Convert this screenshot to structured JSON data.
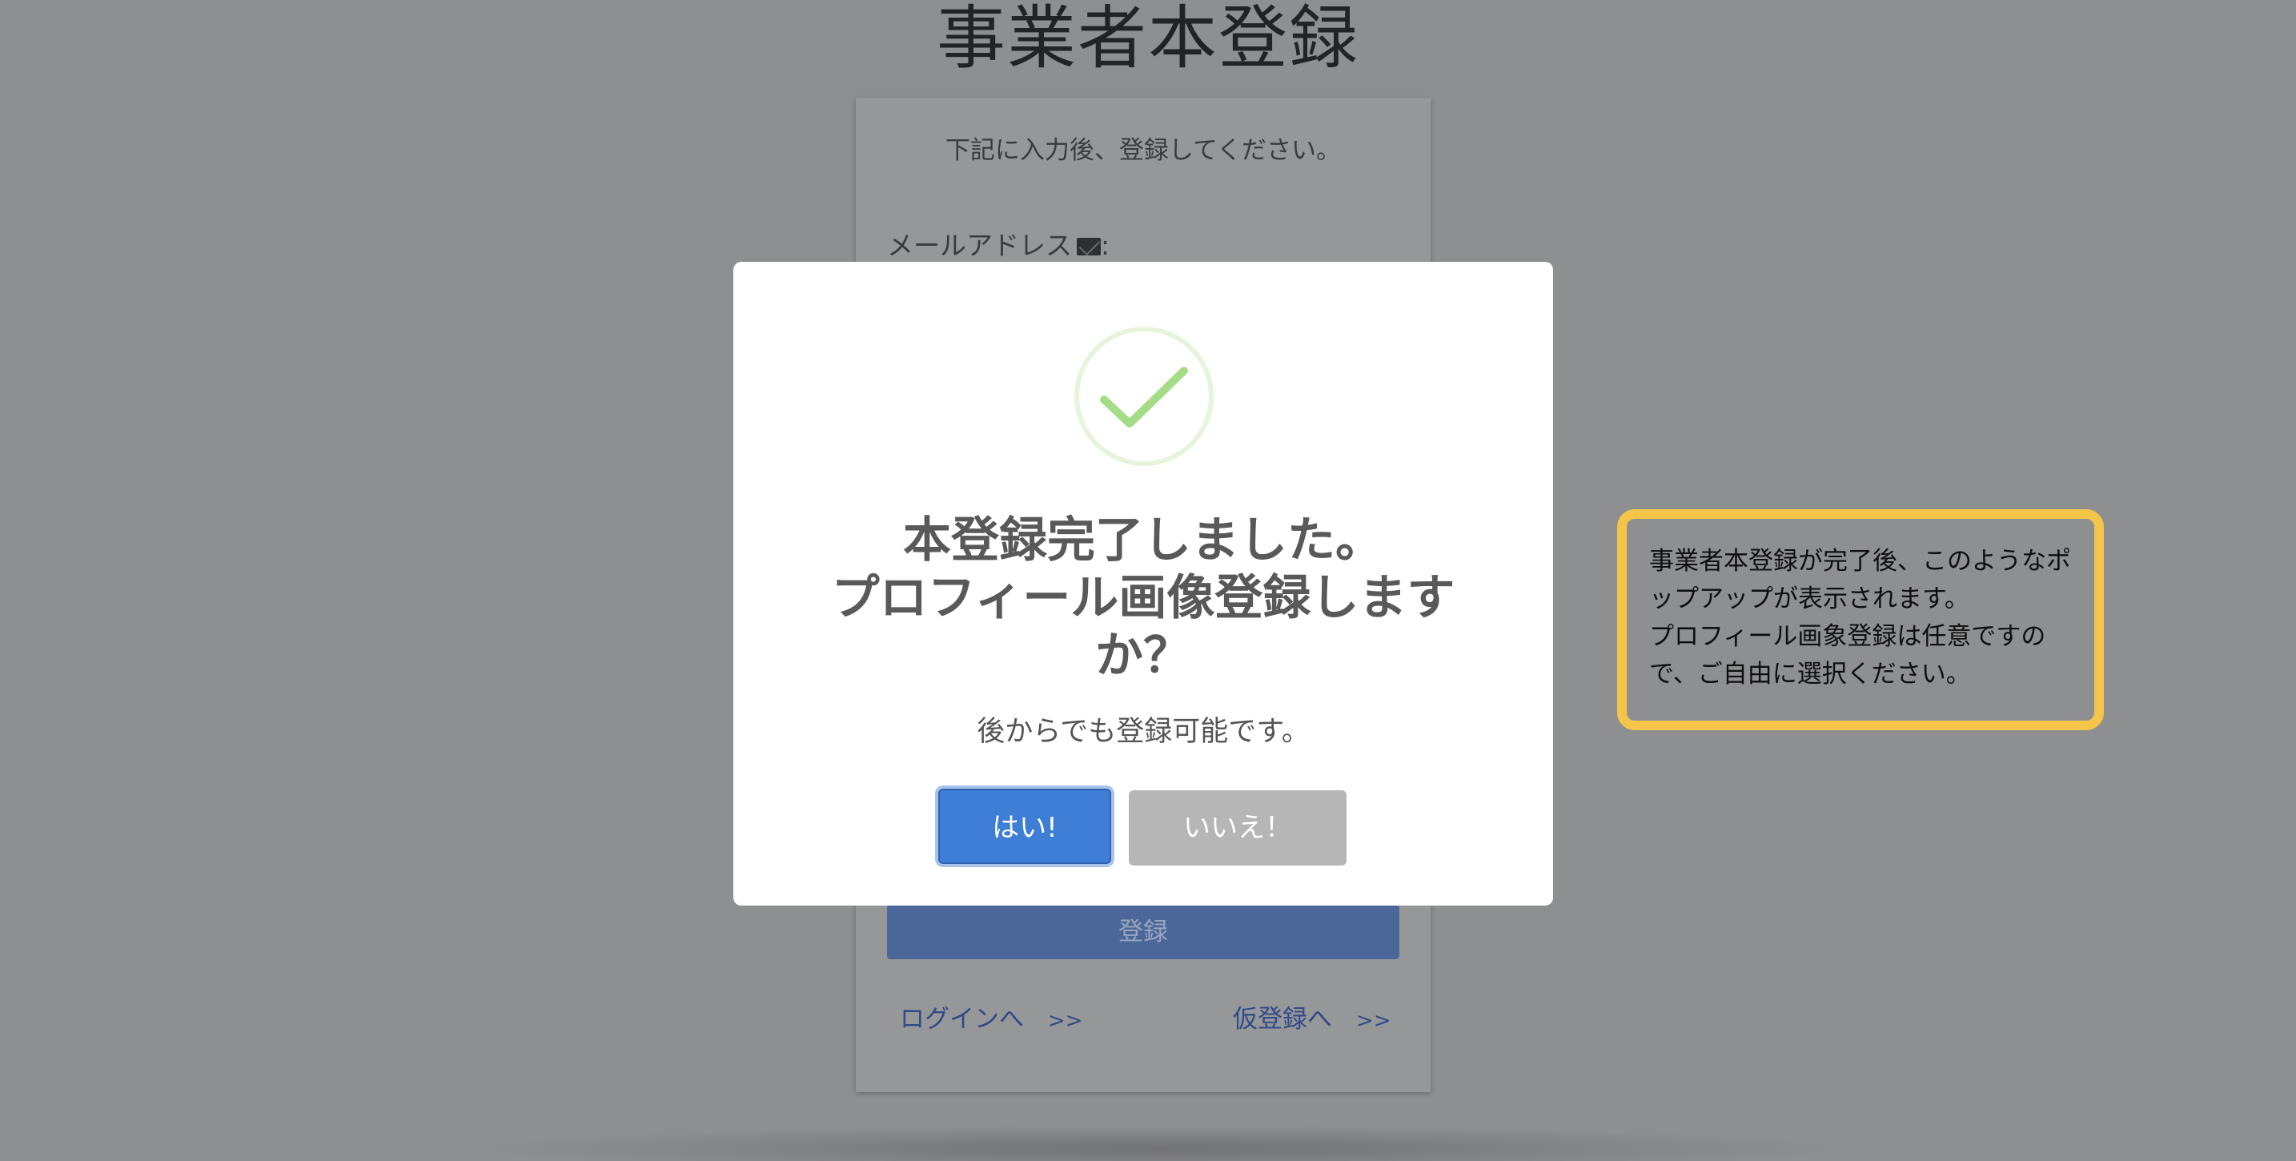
{
  "page": {
    "title": "事業者本登録"
  },
  "form": {
    "instruction": "下記に入力後、登録してください。",
    "email_label": "メールアドレス",
    "email_icon": "envelope-icon",
    "email_colon": ":",
    "register_label": "登録",
    "login_link": "ログインへ",
    "login_arrows": ">>",
    "provisional_link": "仮登録へ",
    "provisional_arrows": ">>"
  },
  "modal": {
    "icon": "success-check-icon",
    "title": "本登録完了しました。\nプロフィール画像登録します\nか？",
    "subtitle": "後からでも登録可能です。",
    "yes_label": "はい!",
    "no_label": "いいえ！"
  },
  "callout": {
    "text": "事業者本登録が完了後、このようなポ\nップアップが表示されます。\nプロフィール画象登録は任意ですの\nで、ご自由に選択ください。"
  },
  "colors": {
    "overlay": "#8e8f91",
    "primary_button": "#3f7ed6",
    "secondary_button": "#b6b6b6",
    "success": "#a5dc86",
    "callout_border": "#f5c54a"
  }
}
